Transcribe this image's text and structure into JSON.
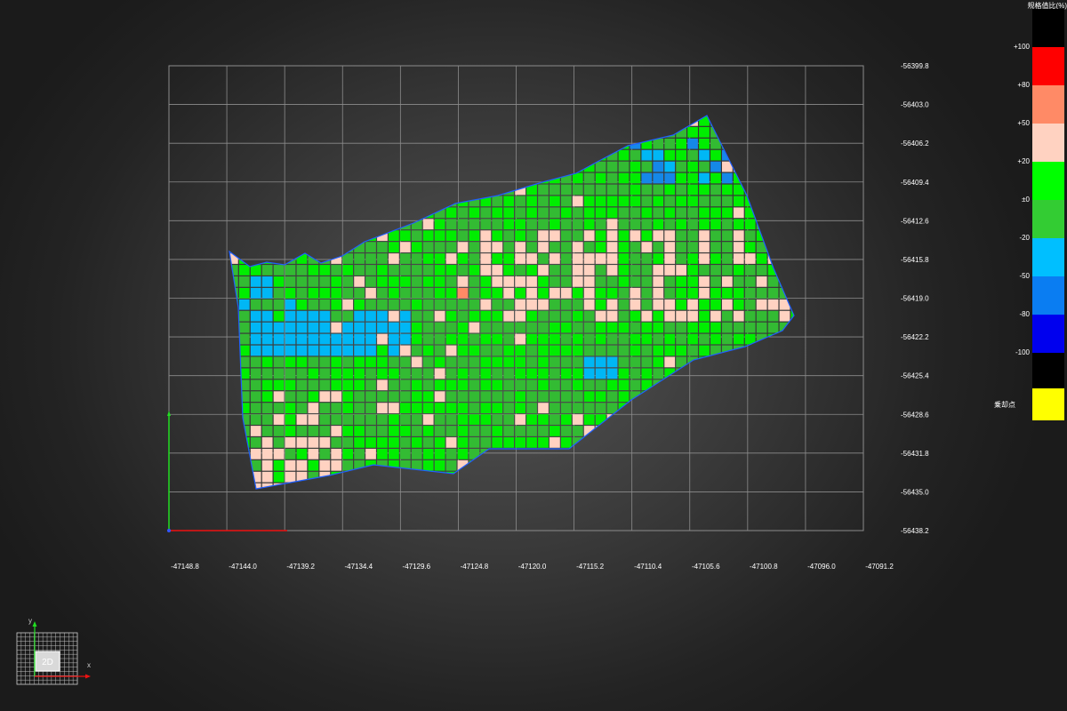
{
  "x_axis_labels": [
    "-47148.8",
    "-47144.0",
    "-47139.2",
    "-47134.4",
    "-47129.6",
    "-47124.8",
    "-47120.0",
    "-47115.2",
    "-47110.4",
    "-47105.6",
    "-47100.8",
    "-47096.0",
    "-47091.2"
  ],
  "y_axis_labels": [
    "-56399.8",
    "-56403.0",
    "-56406.2",
    "-56409.4",
    "-56412.6",
    "-56415.8",
    "-56419.0",
    "-56422.2",
    "-56425.4",
    "-56428.6",
    "-56431.8",
    "-56435.0",
    "-56438.2"
  ],
  "legend": {
    "title": "规格值比(%)",
    "labels": [
      "+100",
      "+80",
      "+50",
      "+20",
      "±0",
      "-20",
      "-50",
      "-80",
      "-100"
    ],
    "colors": [
      "#000000",
      "#ff0000",
      "#ff8a66",
      "#ffd2c1",
      "#00ff00",
      "#33cc33",
      "#00bfff",
      "#0a7df2",
      "#0000ee",
      "#000000"
    ],
    "outlier_label": "乗却点",
    "outlier_color": "#ffff00"
  },
  "view_widget": {
    "mode_label": "2D",
    "x_axis": "x",
    "y_axis": "y"
  }
}
